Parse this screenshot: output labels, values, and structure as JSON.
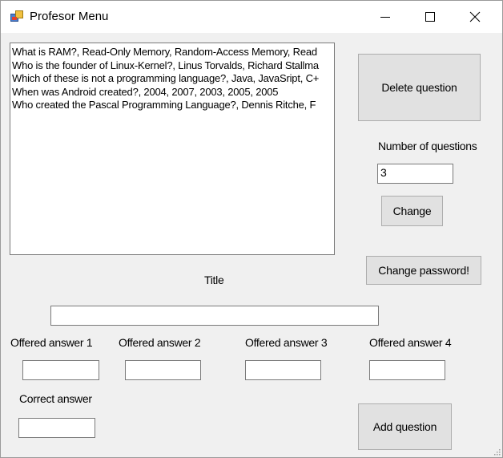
{
  "window": {
    "title": "Profesor Menu"
  },
  "questions_list": {
    "items": [
      "What is RAM?, Read-Only Memory, Random-Access Memory, Read",
      "Who is the founder of Linux-Kernel?, Linus Torvalds, Richard Stallma",
      "Which of these is not a programming language?, Java, JavaSript, C+",
      "When was Android created?, 2004, 2007, 2003, 2005, 2005",
      "Who created the Pascal Programming Language?, Dennis Ritche, F"
    ]
  },
  "buttons": {
    "delete_question": "Delete question",
    "change": "Change",
    "change_password": "Change password!",
    "add_question": "Add question"
  },
  "labels": {
    "number_of_questions": "Number of questions",
    "title": "Title",
    "offered_answer_1": "Offered answer 1",
    "offered_answer_2": "Offered answer 2",
    "offered_answer_3": "Offered answer 3",
    "offered_answer_4": "Offered answer 4",
    "correct_answer": "Correct answer"
  },
  "inputs": {
    "number_of_questions_value": "3",
    "title_value": "",
    "offered_answer_1_value": "",
    "offered_answer_2_value": "",
    "offered_answer_3_value": "",
    "offered_answer_4_value": "",
    "correct_answer_value": ""
  },
  "icons": {
    "app": "app-window-icon",
    "minimize": "minimize-icon",
    "maximize": "maximize-icon",
    "close": "close-icon"
  }
}
